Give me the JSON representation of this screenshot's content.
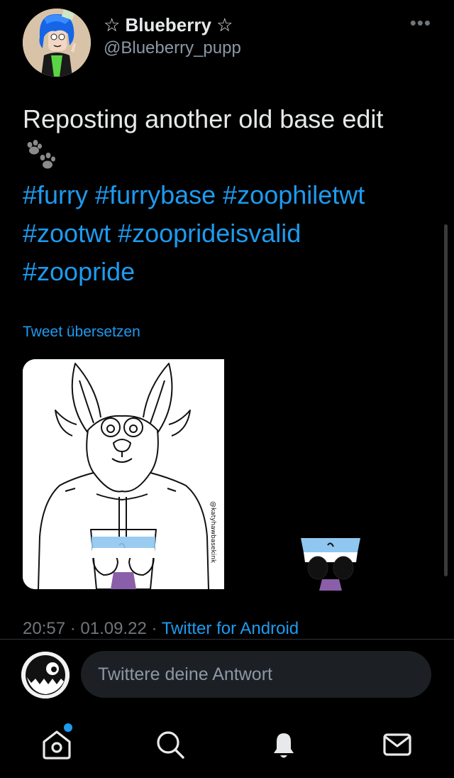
{
  "profile": {
    "display_name": "☆ Blueberry ☆",
    "handle": "@Blueberry_pupp",
    "more_label": "•••"
  },
  "tweet": {
    "text": "Reposting another old base edit",
    "hashtags": [
      "#furry",
      "#furrybase",
      "#zoophiletwt",
      "#zootwt",
      "#zooprideisvalid",
      "#zoopride"
    ],
    "translate_label": "Tweet übersetzen",
    "watermark": "@katyhawbasekink",
    "time": "20:57",
    "date": "01.09.22",
    "source": "Twitter for Android",
    "separator": " · "
  },
  "reply": {
    "placeholder": "Twittere deine Antwort"
  },
  "nav": {
    "items": [
      "home-icon",
      "search-icon",
      "bell-icon",
      "mail-icon"
    ],
    "notification_dot": true
  },
  "colors": {
    "background": "#000000",
    "accent": "#1d9bf0",
    "text": "#e7e9ea",
    "secondary": "#71767b",
    "input_bg": "#1c1f23"
  }
}
